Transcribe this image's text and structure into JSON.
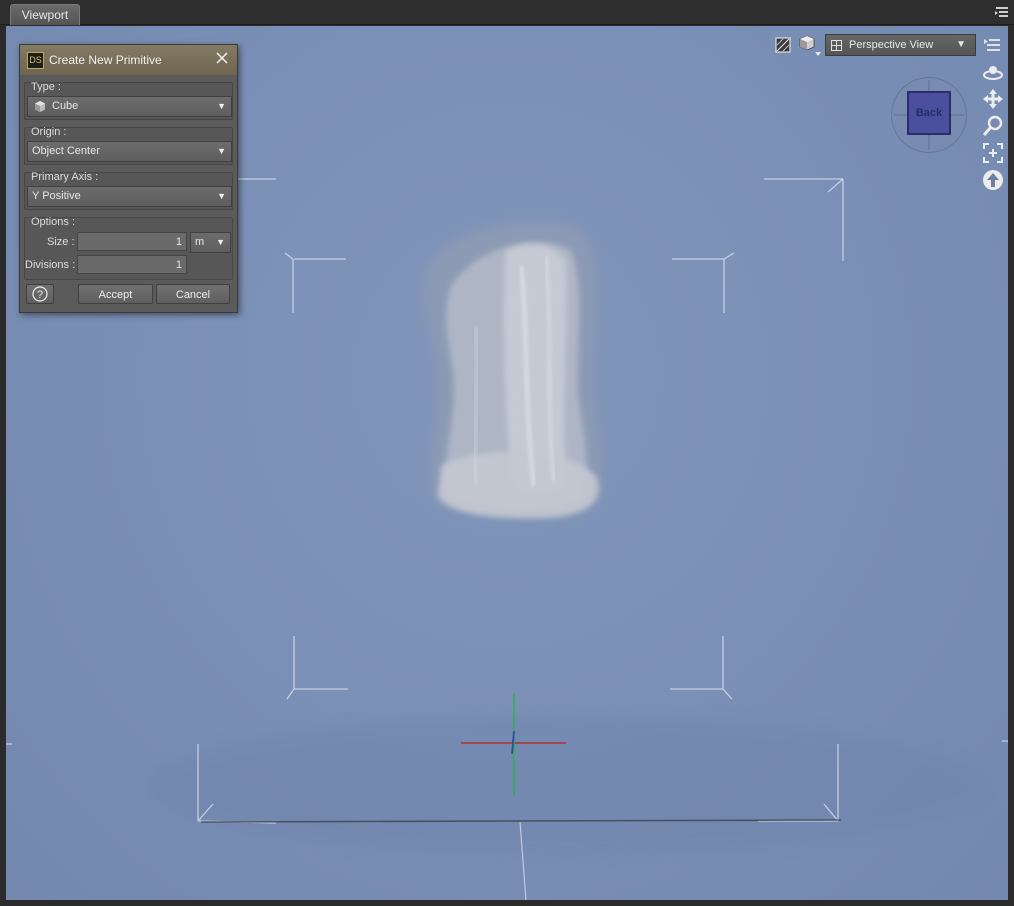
{
  "tabs": [
    {
      "label": "Viewport",
      "active": true
    }
  ],
  "dialog": {
    "title": "Create New Primitive",
    "logo": "DS",
    "type": {
      "label": "Type :",
      "value": "Cube",
      "icon": "cube-icon"
    },
    "origin": {
      "label": "Origin :",
      "value": "Object Center"
    },
    "primary_axis": {
      "label": "Primary Axis :",
      "value": "Y Positive"
    },
    "options": {
      "label": "Options :",
      "size_label": "Size :",
      "size_value": "1",
      "size_unit": "m",
      "divisions_label": "Divisions :",
      "divisions_value": "1"
    },
    "buttons": {
      "help": "?",
      "accept": "Accept",
      "cancel": "Cancel"
    }
  },
  "viewport": {
    "camera": "Perspective View",
    "nav_cube_face": "Back",
    "background_color": "#7b90b6",
    "axis_colors": {
      "x": "#b0303a",
      "y": "#2fb04f",
      "z": "#2c4fa0"
    }
  }
}
